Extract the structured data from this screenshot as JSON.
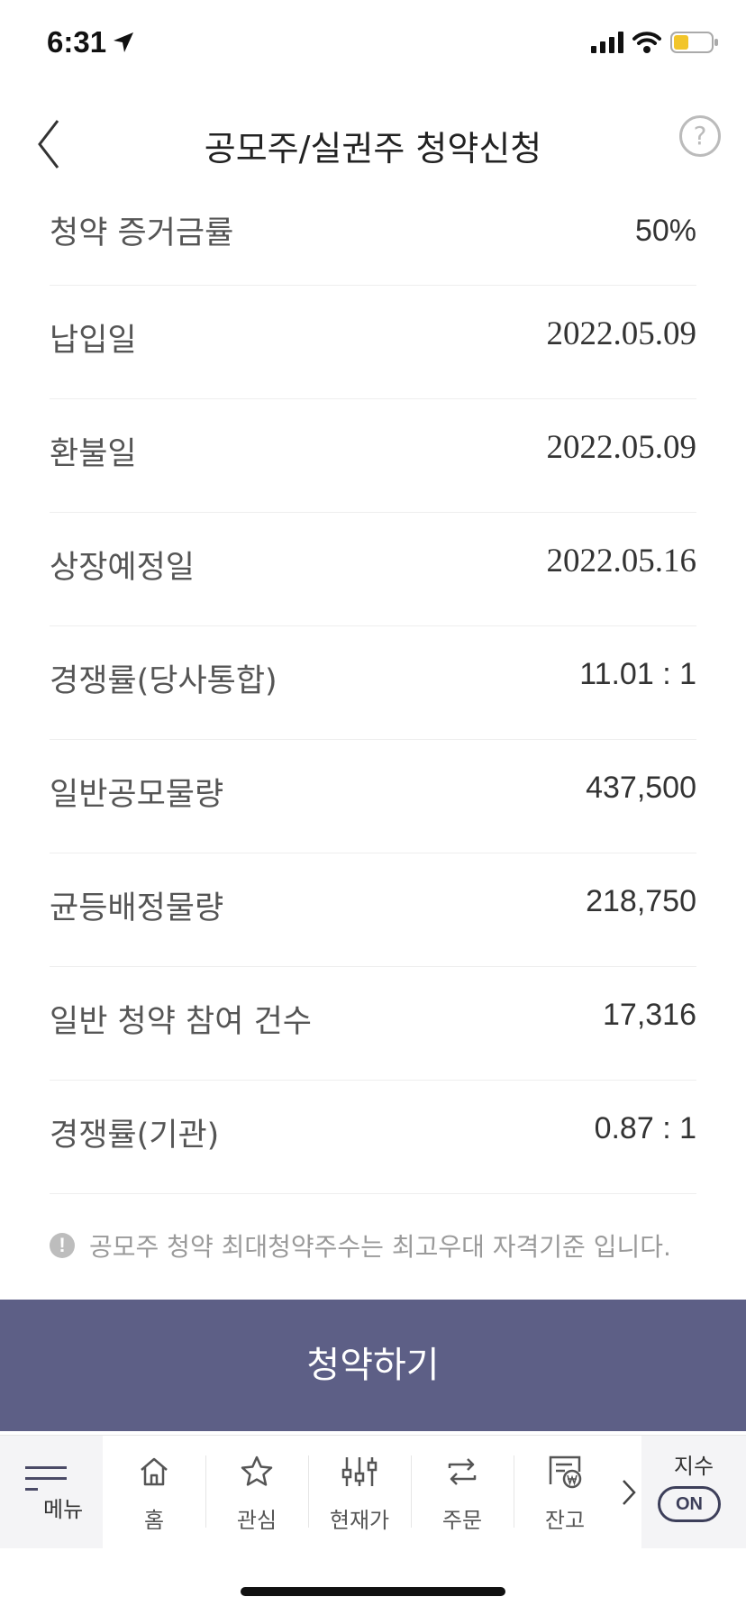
{
  "status_bar": {
    "time": "6:31"
  },
  "header": {
    "title": "공모주/실권주 청약신청",
    "help_glyph": "?"
  },
  "rows": [
    {
      "label": "청약 증거금률",
      "value": "50%"
    },
    {
      "label": "납입일",
      "value": "2022.05.09"
    },
    {
      "label": "환불일",
      "value": "2022.05.09"
    },
    {
      "label": "상장예정일",
      "value": "2022.05.16"
    },
    {
      "label": "경쟁률(당사통합)",
      "value": "11.01 : 1"
    },
    {
      "label": "일반공모물량",
      "value": "437,500"
    },
    {
      "label": "균등배정물량",
      "value": "218,750"
    },
    {
      "label": "일반 청약 참여 건수",
      "value": "17,316"
    },
    {
      "label": "경쟁률(기관)",
      "value": "0.87 : 1"
    }
  ],
  "notice": {
    "icon": "!",
    "text": "공모주 청약 최대청약주수는 최고우대 자격기준 입니다."
  },
  "subscribe_button": {
    "label": "청약하기"
  },
  "bottom_nav": {
    "menu_label": "메뉴",
    "items": [
      {
        "label": "홈",
        "icon": "home-icon"
      },
      {
        "label": "관심",
        "icon": "star-icon"
      },
      {
        "label": "현재가",
        "icon": "sliders-icon"
      },
      {
        "label": "주문",
        "icon": "exchange-icon"
      },
      {
        "label": "잔고",
        "icon": "balance-icon"
      }
    ],
    "index_label": "지수",
    "index_toggle": "ON"
  },
  "colors": {
    "accent": "#5d5f86",
    "nav_bg": "#f4f4f6"
  }
}
